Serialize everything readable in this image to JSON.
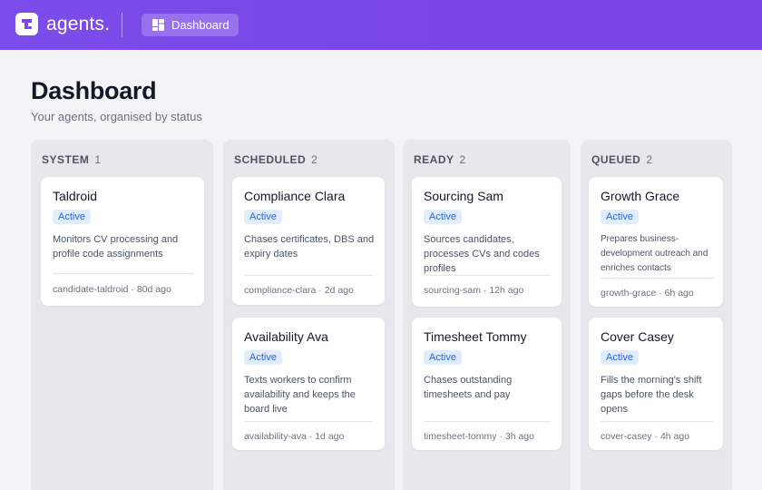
{
  "app": {
    "logo_text": "agents.",
    "nav_label": "Dashboard"
  },
  "page": {
    "title": "Dashboard",
    "subtitle": "Your agents, organised by status"
  },
  "columns": [
    {
      "label": "SYSTEM",
      "count": "1",
      "cards": [
        {
          "title": "Taldroid",
          "badge": "Active",
          "desc": "Monitors CV processing and profile code assignments",
          "slug": "candidate-taldroid",
          "age": "80d ago"
        }
      ]
    },
    {
      "label": "SCHEDULED",
      "count": "2",
      "cards": [
        {
          "title": "Compliance Clara",
          "badge": "Active",
          "desc": "Chases certificates, DBS and expiry dates",
          "slug": "compliance-clara",
          "age": "2d ago"
        },
        {
          "title": "Availability Ava",
          "badge": "Active",
          "desc": "Texts workers to confirm availability and keeps the board live",
          "slug": "availability-ava",
          "age": "1d ago"
        }
      ]
    },
    {
      "label": "READY",
      "count": "2",
      "cards": [
        {
          "title": "Sourcing Sam",
          "badge": "Active",
          "desc": "Sources candidates, processes CVs and codes profiles",
          "slug": "sourcing-sam",
          "age": "12h ago"
        },
        {
          "title": "Timesheet Tommy",
          "badge": "Active",
          "desc": "Chases outstanding timesheets and pay",
          "slug": "timesheet-tommy",
          "age": "3h ago"
        }
      ]
    },
    {
      "label": "QUEUED",
      "count": "2",
      "cards": [
        {
          "title": "Growth Grace",
          "badge": "Active",
          "desc": "Prepares business-development outreach and enriches contacts",
          "slug": "growth-grace",
          "age": "6h ago"
        },
        {
          "title": "Cover Casey",
          "badge": "Active",
          "desc": "Fills the morning's shift gaps before the desk opens",
          "slug": "cover-casey",
          "age": "4h ago"
        }
      ]
    }
  ],
  "meta_separator": "·",
  "colors": {
    "brand": "#7b47e8",
    "badge_bg": "#e0edff",
    "badge_text": "#2563eb"
  },
  "icons": {
    "logo": "agents-logo-icon",
    "nav": "dashboard-grid-icon"
  }
}
